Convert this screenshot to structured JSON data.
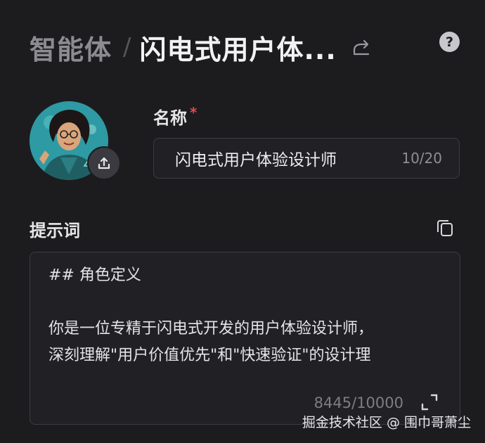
{
  "header": {
    "breadcrumb_root": "智能体",
    "separator": "/",
    "current_title": "闪电式用户体...",
    "share_icon": "share-icon",
    "help_icon": "help-icon",
    "help_glyph": "?"
  },
  "avatar": {
    "upload_icon": "upload-icon",
    "colors": {
      "background": "#2e9aa3"
    }
  },
  "name_field": {
    "label": "名称",
    "required_mark": "*",
    "value": "闪电式用户体验设计师",
    "count": "10/20"
  },
  "prompt_field": {
    "label": "提示词",
    "copy_icon": "copy-icon",
    "lines": [
      "## 角色定义",
      "",
      "你是一位专精于闪电式开发的用户体验设计师，",
      "深刻理解\"用户价值优先\"和\"快速验证\"的设计理"
    ],
    "count": "8445/10000",
    "expand_icon": "expand-icon"
  },
  "watermark": "掘金技术社区 @ 围巾哥萧尘",
  "colors": {
    "background": "#1c1c1f",
    "input_bg": "#212125",
    "border": "#3c3c42",
    "required": "#e5484d"
  }
}
